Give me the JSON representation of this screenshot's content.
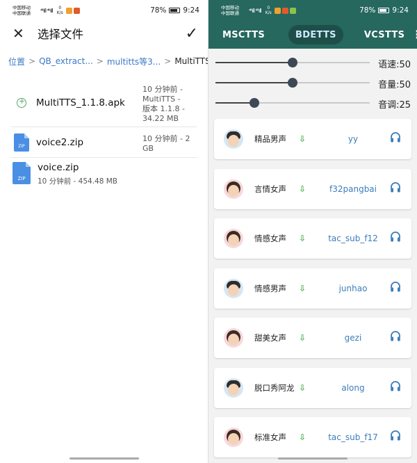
{
  "left": {
    "status": {
      "carrier1": "中国移动",
      "carrier2": "中国联通",
      "signal": "⁴⁶ıll ⁴⁶ıll",
      "speed_value": "0",
      "speed_unit": "K/s",
      "battery": "78%",
      "time": "9:24"
    },
    "header": {
      "title": "选择文件"
    },
    "breadcrumb": [
      "位置",
      "QB_extract...",
      "multitts等3...",
      "MultiTTS"
    ],
    "files": [
      {
        "name": "MultiTTS_1.1.8.apk",
        "meta": [
          "10 分钟前 -",
          "MultiTTS -",
          "版本 1.1.8 -",
          "34.22 MB"
        ]
      },
      {
        "name": "voice2.zip",
        "meta": [
          "10 分钟前 - 2",
          "GB"
        ]
      },
      {
        "name": "voice.zip",
        "meta": [
          "10 分钟前 - 454.48 MB"
        ]
      }
    ],
    "zip_label": "ZIP"
  },
  "right": {
    "status": {
      "carrier1": "中国移动",
      "carrier2": "中国联通",
      "signal": "⁴⁶ıll ⁴⁶ıll",
      "speed_value": "0",
      "speed_unit": "K/s",
      "battery": "78%",
      "time": "9:24"
    },
    "tabs": [
      "MSCTTS",
      "BDETTS",
      "VCSTTS"
    ],
    "active_tab": "BDETTS",
    "sliders": [
      {
        "label": "语速:50",
        "value": 50
      },
      {
        "label": "音量:50",
        "value": 50
      },
      {
        "label": "音调:25",
        "value": 25
      }
    ],
    "voices": [
      {
        "name": "精品男声",
        "id": "yy",
        "gender": "m"
      },
      {
        "name": "言情女声",
        "id": "f32pangbai",
        "gender": "f"
      },
      {
        "name": "情感女声",
        "id": "tac_sub_f12",
        "gender": "f"
      },
      {
        "name": "情感男声",
        "id": "junhao",
        "gender": "m"
      },
      {
        "name": "甜美女声",
        "id": "gezi",
        "gender": "f"
      },
      {
        "name": "脱口秀阿龙",
        "id": "along",
        "gender": "m"
      },
      {
        "name": "标准女声",
        "id": "tac_sub_f17",
        "gender": "f"
      }
    ],
    "colors": {
      "accent": "#26675e",
      "download": "#4caf50",
      "link": "#3b7dbb"
    }
  }
}
